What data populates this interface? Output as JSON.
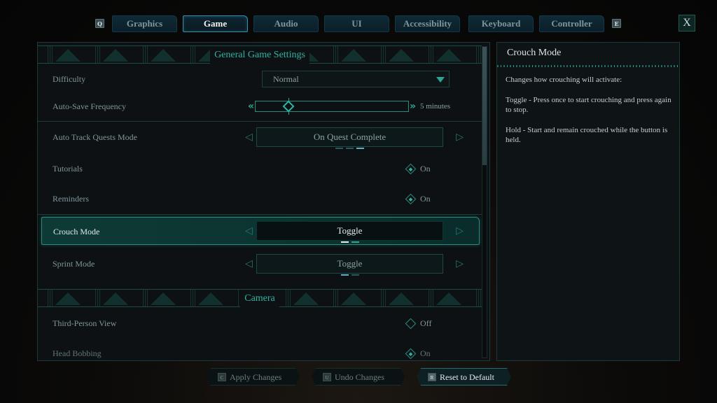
{
  "tabs": {
    "prev_key": "Q",
    "next_key": "E",
    "items": [
      {
        "label": "Graphics",
        "active": false
      },
      {
        "label": "Game",
        "active": true
      },
      {
        "label": "Audio",
        "active": false
      },
      {
        "label": "UI",
        "active": false
      },
      {
        "label": "Accessibility",
        "active": false
      },
      {
        "label": "Keyboard",
        "active": false
      },
      {
        "label": "Controller",
        "active": false
      }
    ],
    "close_label": "X"
  },
  "sections": {
    "general": {
      "title": "General Game Settings",
      "difficulty": {
        "label": "Difficulty",
        "value": "Normal"
      },
      "autosave": {
        "label": "Auto-Save Frequency",
        "value": "5 minutes",
        "position_fraction": 0.22
      },
      "auto_track": {
        "label": "Auto Track Quests Mode",
        "value": "On Quest Complete",
        "option_index": 2,
        "option_count": 3
      },
      "tutorials": {
        "label": "Tutorials",
        "value": "On",
        "checked": true
      },
      "reminders": {
        "label": "Reminders",
        "value": "On",
        "checked": true
      },
      "crouch": {
        "label": "Crouch Mode",
        "value": "Toggle",
        "option_index": 0,
        "option_count": 2,
        "selected": true
      },
      "sprint": {
        "label": "Sprint Mode",
        "value": "Toggle",
        "option_index": 0,
        "option_count": 2
      }
    },
    "camera": {
      "title": "Camera",
      "third_person": {
        "label": "Third-Person View",
        "value": "Off",
        "checked": false
      },
      "head_bobbing": {
        "label": "Head Bobbing",
        "value": "On",
        "checked": true
      }
    }
  },
  "scrollbar": {
    "thumb_fraction": 0.38
  },
  "description": {
    "title": "Crouch Mode",
    "paragraphs": [
      "Changes how crouching will activate:",
      "Toggle - Press once to start crouching and press again to stop.",
      "Hold - Start and remain crouched while the button is held."
    ]
  },
  "footer": {
    "apply": {
      "key": "C",
      "label": "Apply Changes"
    },
    "undo": {
      "key": "U",
      "label": "Undo Changes"
    },
    "reset": {
      "key": "R",
      "label": "Reset to Default"
    }
  },
  "colors": {
    "accent": "#2fb3a2",
    "panel_bg": "#0d1113",
    "selected_row": "#0e3a36"
  }
}
